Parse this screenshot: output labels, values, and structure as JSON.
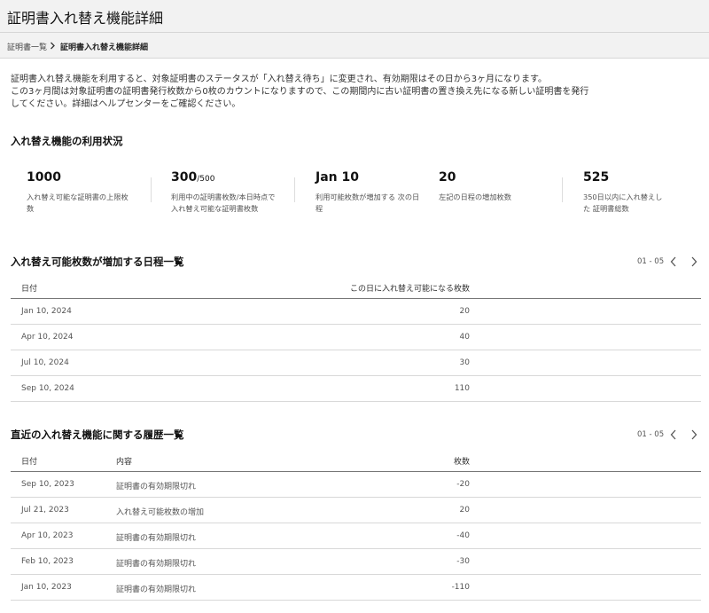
{
  "header": {
    "title": "証明書入れ替え機能詳細"
  },
  "breadcrumb": {
    "parent": "証明書一覧",
    "current": "証明書入れ替え機能詳細"
  },
  "intro": [
    "証明書入れ替え機能を利用すると、対象証明書のステータスが「入れ替え待ち」に変更され、有効期限はその日から3ヶ月になります。",
    "この3ヶ月間は対象証明書の証明書発行枚数から0枚のカウントになりますので、この期間内に古い証明書の置き換え先になる新しい証明書を発行",
    "してください。詳細はヘルプセンターをご確認ください。"
  ],
  "usage": {
    "heading": "入れ替え機能の利用状況",
    "stats": [
      {
        "value": "1000",
        "unit": "",
        "label": "入れ替え可能な証明書の上限枚数"
      },
      {
        "value": "300",
        "unit": "/500",
        "label": "利用中の証明書枚数/本日時点で入れ替え可能な証明書枚数"
      },
      {
        "value": "Jan 10",
        "unit": "",
        "label": "利用可能枚数が増加する 次の日程"
      },
      {
        "value": "20",
        "unit": "",
        "label": "左記の日程の増加枚数"
      },
      {
        "value": "525",
        "unit": "",
        "label": "350日以内に入れ替えした 証明書総数"
      }
    ]
  },
  "schedule": {
    "heading": "入れ替え可能枚数が増加する日程一覧",
    "pager": "01 - 05",
    "columns": {
      "date": "日付",
      "count": "この日に入れ替え可能になる枚数"
    },
    "rows": [
      {
        "date": "Jan 10, 2024",
        "count": "20"
      },
      {
        "date": "Apr 10, 2024",
        "count": "40"
      },
      {
        "date": "Jul 10, 2024",
        "count": "30"
      },
      {
        "date": "Sep 10, 2024",
        "count": "110"
      }
    ]
  },
  "history": {
    "heading": "直近の入れ替え機能に関する履歴一覧",
    "pager": "01 - 05",
    "columns": {
      "date": "日付",
      "content": "内容",
      "count": "枚数"
    },
    "rows": [
      {
        "date": "Sep 10, 2023",
        "content": "証明書の有効期限切れ",
        "count": "-20"
      },
      {
        "date": "Jul 21, 2023",
        "content": "入れ替え可能枚数の増加",
        "count": "20"
      },
      {
        "date": "Apr 10, 2023",
        "content": "証明書の有効期限切れ",
        "count": "-40"
      },
      {
        "date": "Feb 10, 2023",
        "content": "証明書の有効期限切れ",
        "count": "-30"
      },
      {
        "date": "Jan 10, 2023",
        "content": "証明書の有効期限切れ",
        "count": "-110"
      }
    ]
  }
}
